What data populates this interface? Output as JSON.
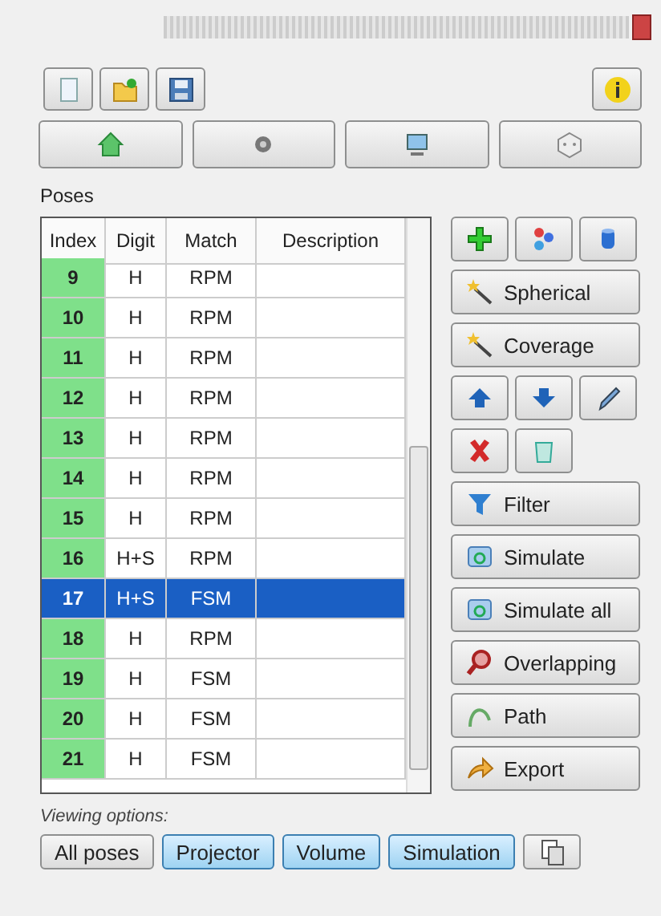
{
  "group_label": "Poses",
  "table": {
    "columns": [
      "Index",
      "Digit",
      "Match",
      "Description"
    ],
    "rows": [
      {
        "index": "9",
        "digit": "H",
        "match": "RPM",
        "selected": false
      },
      {
        "index": "10",
        "digit": "H",
        "match": "RPM",
        "selected": false
      },
      {
        "index": "11",
        "digit": "H",
        "match": "RPM",
        "selected": false
      },
      {
        "index": "12",
        "digit": "H",
        "match": "RPM",
        "selected": false
      },
      {
        "index": "13",
        "digit": "H",
        "match": "RPM",
        "selected": false
      },
      {
        "index": "14",
        "digit": "H",
        "match": "RPM",
        "selected": false
      },
      {
        "index": "15",
        "digit": "H",
        "match": "RPM",
        "selected": false
      },
      {
        "index": "16",
        "digit": "H+S",
        "match": "RPM",
        "selected": false
      },
      {
        "index": "17",
        "digit": "H+S",
        "match": "FSM",
        "selected": true
      },
      {
        "index": "18",
        "digit": "H",
        "match": "RPM",
        "selected": false
      },
      {
        "index": "19",
        "digit": "H",
        "match": "FSM",
        "selected": false
      },
      {
        "index": "20",
        "digit": "H",
        "match": "FSM",
        "selected": false
      },
      {
        "index": "21",
        "digit": "H",
        "match": "FSM",
        "selected": false
      }
    ]
  },
  "tools": [
    "Spherical",
    "Coverage",
    "Filter",
    "Simulate",
    "Simulate all",
    "Overlapping",
    "Path",
    "Export"
  ],
  "viewing_label": "Viewing options:",
  "view_buttons": [
    {
      "label": "All poses",
      "selected": false
    },
    {
      "label": "Projector",
      "selected": true
    },
    {
      "label": "Volume",
      "selected": true
    },
    {
      "label": "Simulation",
      "selected": true
    }
  ]
}
